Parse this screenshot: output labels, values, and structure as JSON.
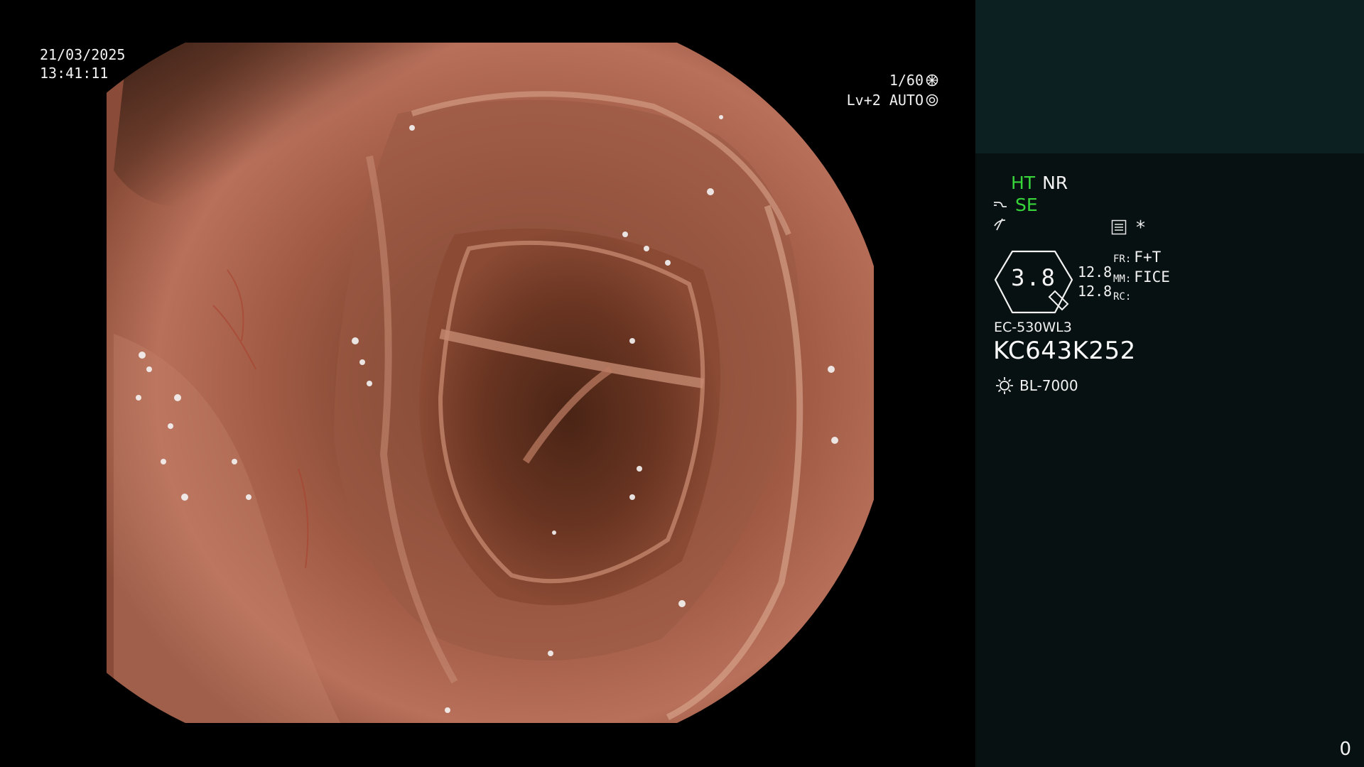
{
  "overlay": {
    "date": "21/03/2025",
    "time": "13:41:11",
    "shutter": "1/60",
    "level": "Lv+2 AUTO"
  },
  "side_panel": {
    "mode_ht": "HT",
    "mode_nr": "NR",
    "mode_se": "SE",
    "asterisk": "*",
    "zoom": "3.8",
    "param_1": "12.8",
    "param_2": "12.8",
    "fr_label": "FR:",
    "fr_value": "F+T",
    "mm_label": "MM:",
    "mm_value": "FICE",
    "rc_label": "RC:",
    "scope_model": "EC-530WL3",
    "serial": "KC643K252",
    "light_source": "BL-7000",
    "counter": "0"
  },
  "icons": [
    "shutter-icon",
    "auto-iris-icon",
    "enhance-icon",
    "structure-icon",
    "menu-icon",
    "zoom-lens-icon",
    "light-source-icon"
  ],
  "colors": {
    "accent_green": "#37d53a",
    "panel_bg": "#081112",
    "thumb_bg": "#0c1f21"
  }
}
